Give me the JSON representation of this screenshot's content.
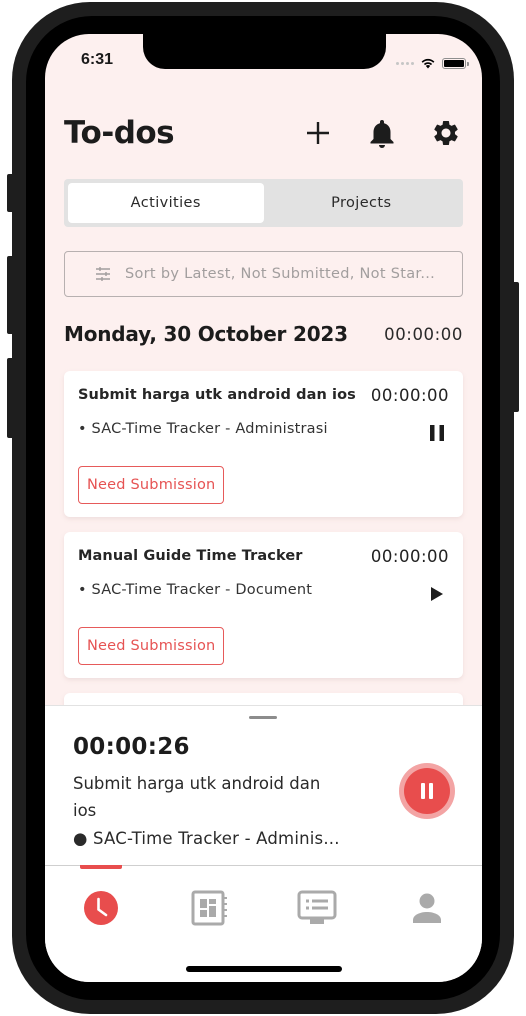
{
  "status_bar": {
    "time": "6:31",
    "wifi_icon": "wifi-icon",
    "battery_icon": "battery-icon"
  },
  "header": {
    "title": "To-dos",
    "actions": [
      {
        "name": "add",
        "icon": "plus-icon"
      },
      {
        "name": "notifications",
        "icon": "bell-icon"
      },
      {
        "name": "settings",
        "icon": "gear-icon"
      }
    ]
  },
  "tabs": [
    {
      "label": "Activities",
      "active": true
    },
    {
      "label": "Projects",
      "active": false
    }
  ],
  "filter": {
    "icon": "sliders-icon",
    "text": "Sort by Latest, Not Submitted, Not Star..."
  },
  "day": {
    "date": "Monday, 30 October 2023",
    "total": "00:00:00"
  },
  "activities": [
    {
      "title": "Submit harga utk android dan ios",
      "time": "00:00:00",
      "project": "• SAC-Time Tracker - Administrasi",
      "action_icon": "pause-icon",
      "badge": "Need Submission"
    },
    {
      "title": "Manual Guide Time Tracker",
      "time": "00:00:00",
      "project": "• SAC-Time Tracker - Document",
      "action_icon": "play-icon",
      "badge": "Need Submission"
    }
  ],
  "running_timer": {
    "elapsed": "00:00:26",
    "title": "Submit harga utk android dan ios",
    "project": "● SAC-Time Tracker - Adminis...",
    "action_icon": "pause-icon"
  },
  "bottom_nav": [
    {
      "name": "timer",
      "icon": "clock-icon",
      "active": true
    },
    {
      "name": "timesheet",
      "icon": "dashboard-notebook-icon",
      "active": false
    },
    {
      "name": "reports",
      "icon": "monitor-list-icon",
      "active": false
    },
    {
      "name": "profile",
      "icon": "person-icon",
      "active": false
    }
  ],
  "colors": {
    "accent": "#e84d4d",
    "accent_light": "#f3a4a4",
    "screen_bg": "#fdf0ef",
    "inactive_icon": "#aaaaaa"
  }
}
